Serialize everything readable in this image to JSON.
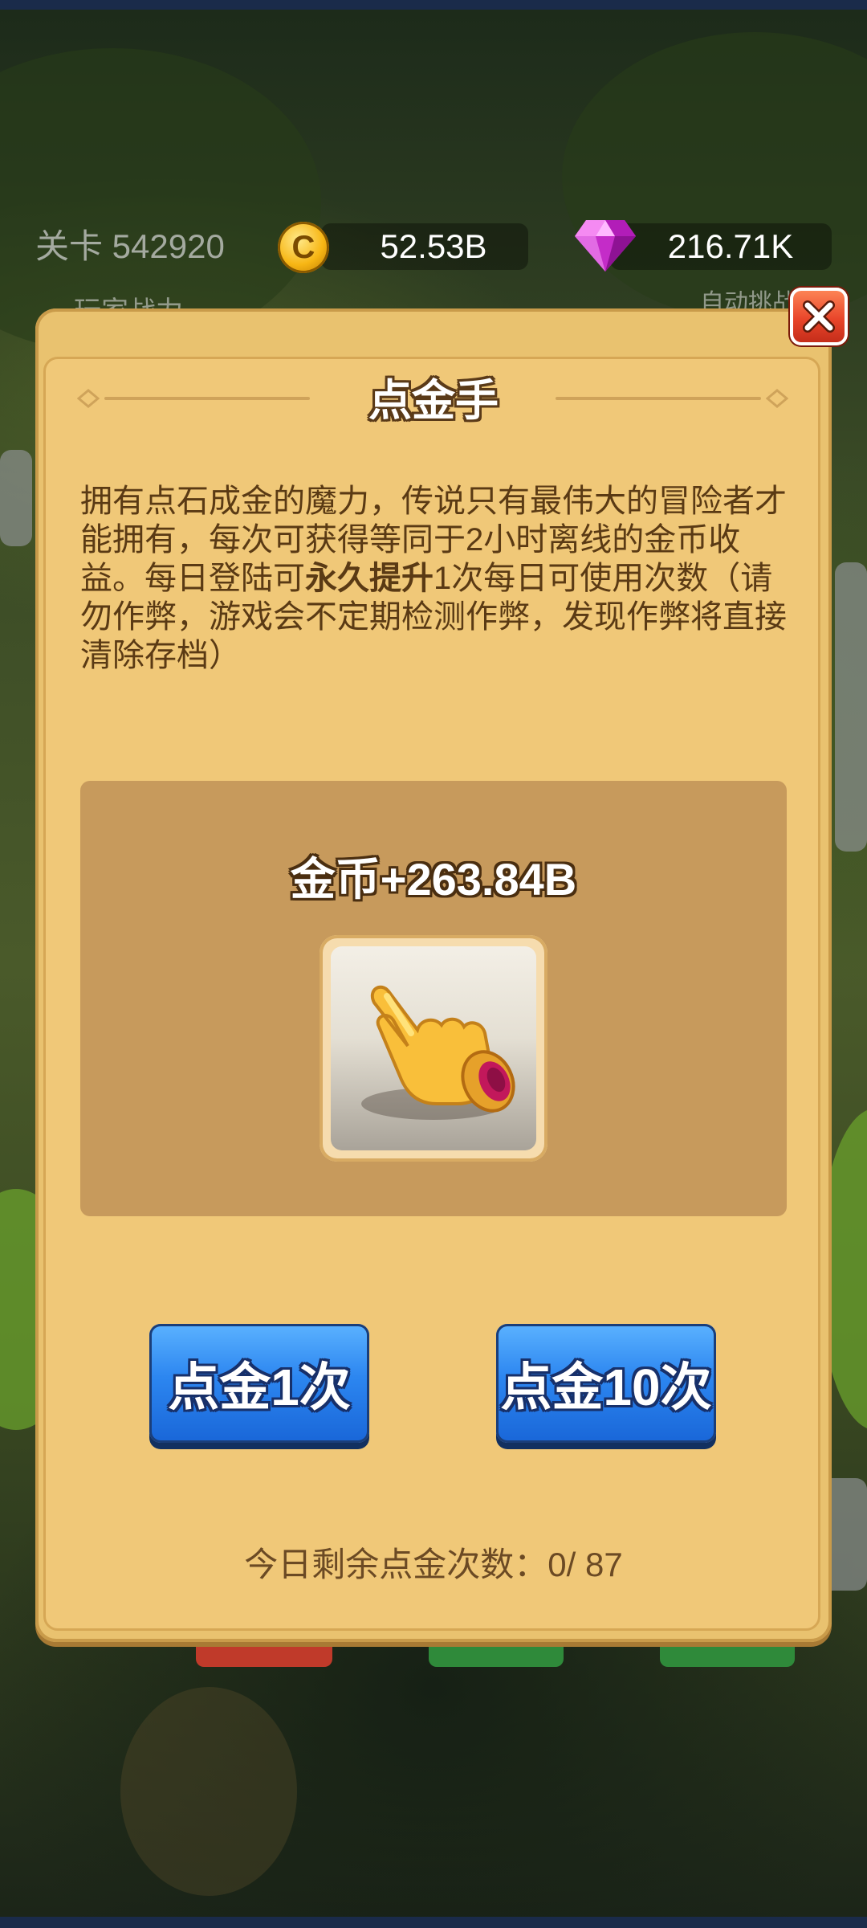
{
  "hud": {
    "level_label": "关卡 542920",
    "coins": "52.53B",
    "coin_symbol": "C",
    "gems": "216.71K",
    "bg_label_left": "玩家战力",
    "bg_label_right": "自动挑战"
  },
  "dialog": {
    "title": "点金手",
    "description_part1": "拥有点石成金的魔力，传说只有最伟大的冒险者才能拥有，每次可获得等同于2小时离线的金币收益。每日登陆可",
    "description_bold": "永久提升",
    "description_part2": "1次每日可使用次数（请勿作弊，游戏会不定期检测作弊，发现作弊将直接清除存档）",
    "reward_text": "金币+263.84B",
    "button_once": "点金1次",
    "button_ten": "点金10次",
    "remaining_text": "今日剩余点金次数：0/ 87"
  },
  "colors": {
    "dialog_bg": "#f0c878",
    "panel_bg": "#c79a5c",
    "button_blue": "#2c86f0",
    "close_red": "#e8452a",
    "text_brown": "#5a3a14"
  },
  "icons": {
    "coin": "coin-icon",
    "gem": "gem-icon",
    "close": "close-icon",
    "item": "pointing-hand-icon"
  }
}
